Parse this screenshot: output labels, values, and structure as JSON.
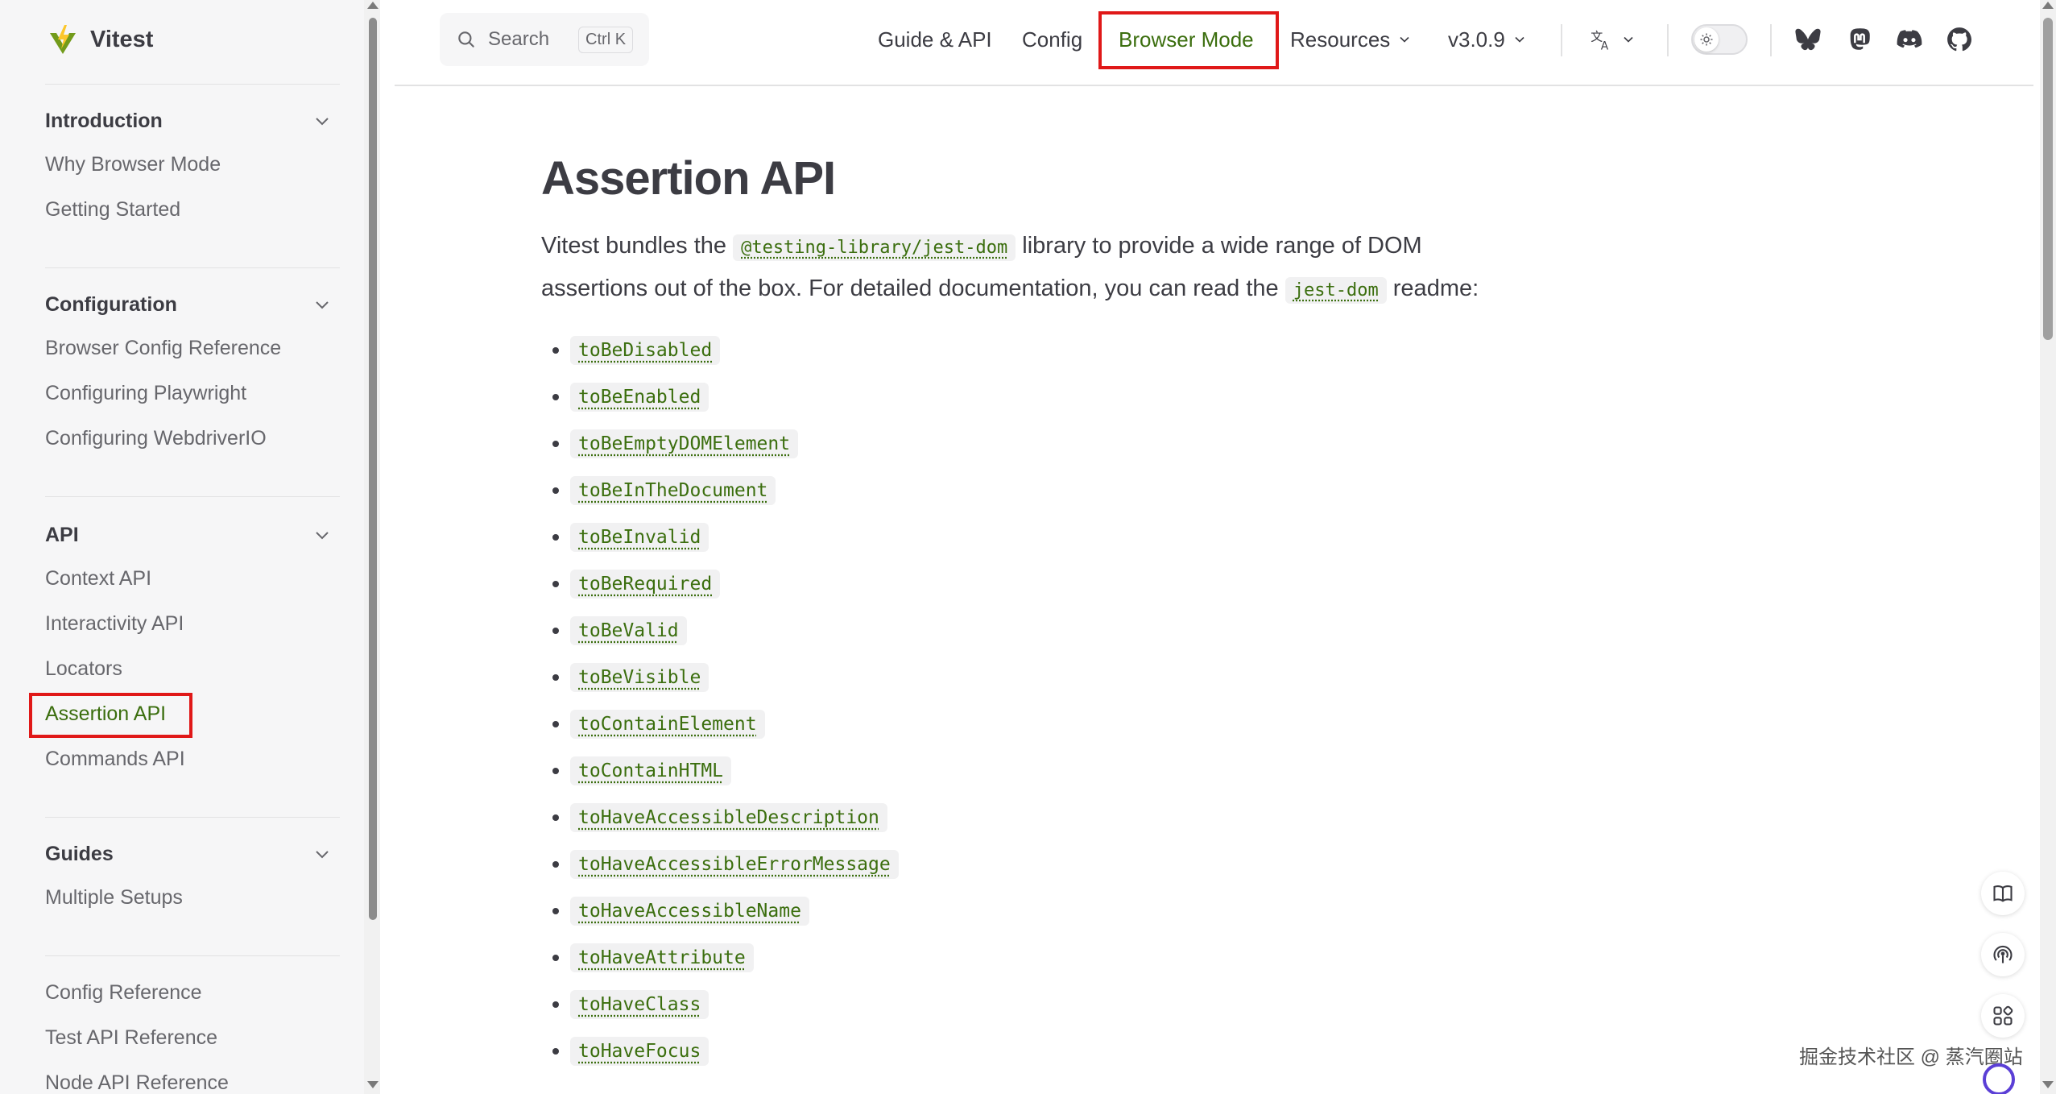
{
  "app": {
    "name": "Vitest"
  },
  "sidebar": {
    "groups": [
      {
        "title": "Introduction",
        "items": [
          "Why Browser Mode",
          "Getting Started"
        ]
      },
      {
        "title": "Configuration",
        "items": [
          "Browser Config Reference",
          "Configuring Playwright",
          "Configuring WebdriverIO"
        ]
      },
      {
        "title": "API",
        "items": [
          "Context API",
          "Interactivity API",
          "Locators",
          "Assertion API",
          "Commands API"
        ]
      },
      {
        "title": "Guides",
        "items": [
          "Multiple Setups"
        ]
      }
    ],
    "footer_items": [
      "Config Reference",
      "Test API Reference",
      "Node API Reference"
    ],
    "active_item": "Assertion API"
  },
  "search": {
    "label": "Search",
    "shortcut": "Ctrl K"
  },
  "nav": {
    "guide": "Guide & API",
    "config": "Config",
    "browser_mode": "Browser Mode",
    "resources": "Resources",
    "version": "v3.0.9"
  },
  "page": {
    "title": "Assertion API",
    "intro": {
      "part1": "Vitest bundles the ",
      "code1": "@testing-library/jest-dom",
      "part2": " library to provide a wide range of DOM assertions out of the box. For detailed documentation, you can read the ",
      "code2": "jest-dom",
      "part3": " readme:"
    },
    "matchers": [
      "toBeDisabled",
      "toBeEnabled",
      "toBeEmptyDOMElement",
      "toBeInTheDocument",
      "toBeInvalid",
      "toBeRequired",
      "toBeValid",
      "toBeVisible",
      "toContainElement",
      "toContainHTML",
      "toHaveAccessibleDescription",
      "toHaveAccessibleErrorMessage",
      "toHaveAccessibleName",
      "toHaveAttribute",
      "toHaveClass",
      "toHaveFocus"
    ]
  },
  "watermark": "掘金技术社区 @ 蒸汽圈站",
  "colors": {
    "brand": "#3b6e0e",
    "text": "#3c3c43",
    "muted": "#67676c",
    "sidebar_bg": "#f6f6f7",
    "highlight": "#e01818"
  }
}
